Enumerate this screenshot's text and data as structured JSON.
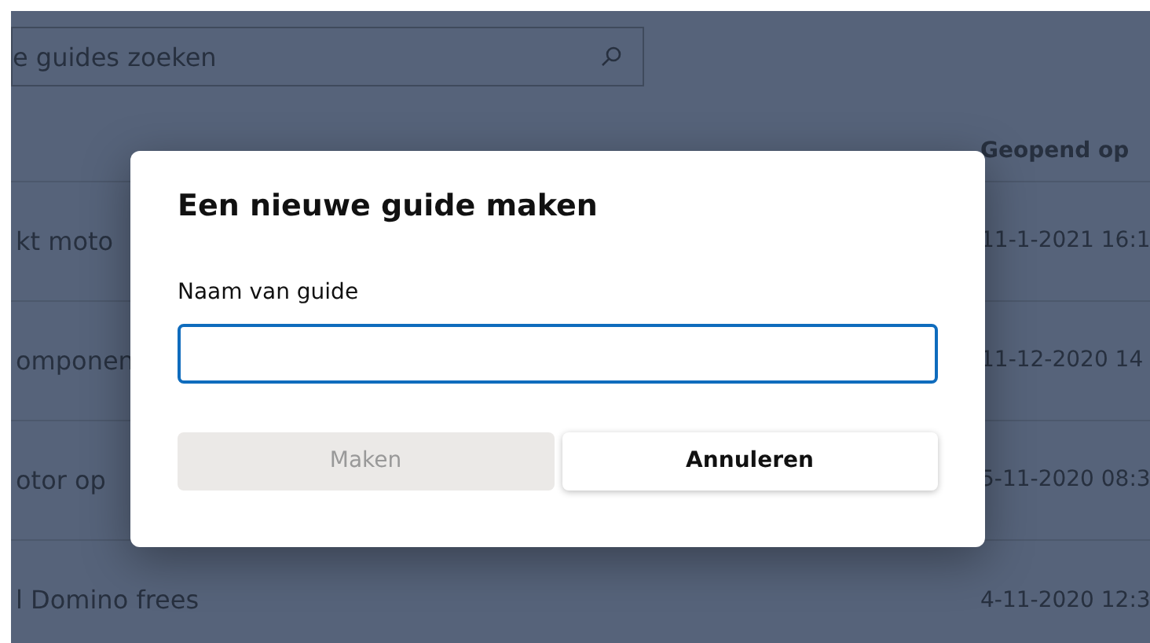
{
  "search": {
    "placeholder": "e guides zoeken"
  },
  "table": {
    "columns": [
      "Geopend op"
    ],
    "rows": [
      {
        "name": "kt moto",
        "opened": "11-1-2021 16:1"
      },
      {
        "name": "omponen",
        "opened": "11-12-2020 14"
      },
      {
        "name": "otor op",
        "opened": "5-11-2020 08:3"
      },
      {
        "name": "l Domino frees",
        "opened": "4-11-2020 12:3"
      }
    ]
  },
  "dialog": {
    "title": "Een nieuwe guide maken",
    "field_label": "Naam van guide",
    "buttons": [
      {
        "label": "Maken",
        "kind": "primary",
        "disabled": true
      },
      {
        "label": "Annuleren",
        "kind": "secondary",
        "disabled": false
      }
    ]
  }
}
